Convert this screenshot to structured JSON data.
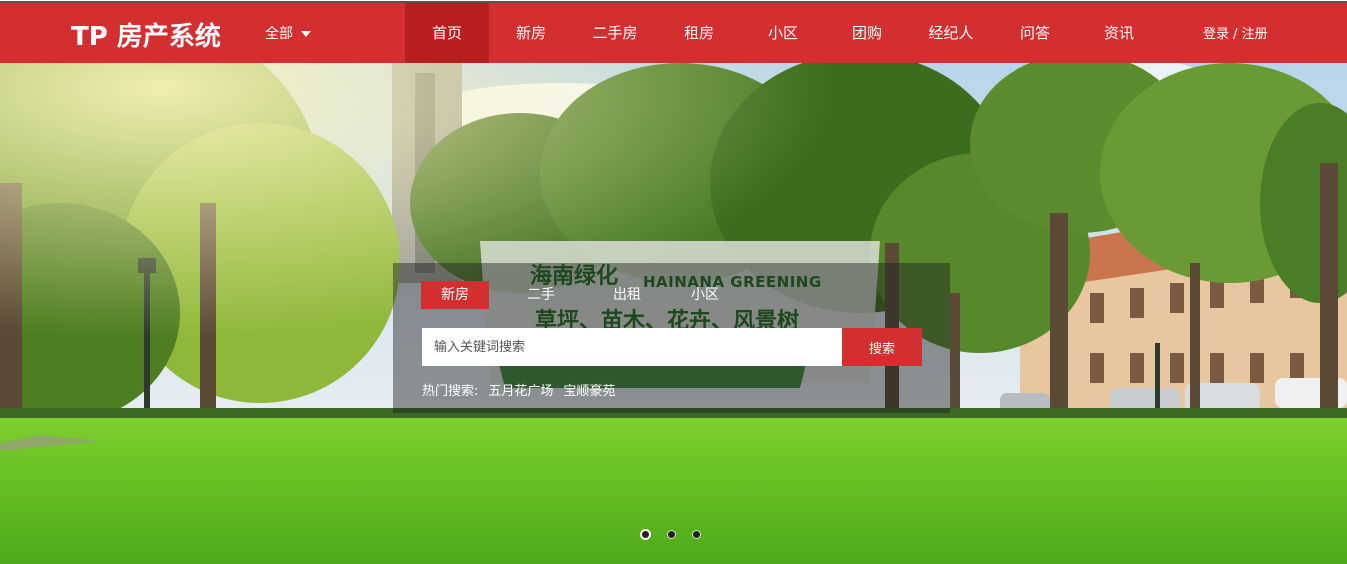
{
  "header": {
    "logo": "TP 房产系统",
    "category_label": "全部",
    "nav": [
      {
        "label": "首页",
        "active": true
      },
      {
        "label": "新房",
        "active": false
      },
      {
        "label": "二手房",
        "active": false
      },
      {
        "label": "租房",
        "active": false
      },
      {
        "label": "小区",
        "active": false
      },
      {
        "label": "团购",
        "active": false
      },
      {
        "label": "经纪人",
        "active": false
      },
      {
        "label": "问答",
        "active": false
      },
      {
        "label": "资讯",
        "active": false
      }
    ],
    "login_label": "登录",
    "separator": " / ",
    "register_label": "注册"
  },
  "hero": {
    "sign": {
      "title": "海南绿化",
      "english": "HAINANA GREENING",
      "subtitle": "草坪、苗木、花卉、风景树"
    },
    "search": {
      "tabs": [
        "新房",
        "二手",
        "出租",
        "小区"
      ],
      "active_tab": 0,
      "placeholder": "输入关键词搜索",
      "value": "",
      "button_label": "搜索",
      "hot_label": "热门搜索:",
      "hot_keywords": [
        "五月花广场",
        "宝顺豪苑"
      ]
    },
    "carousel": {
      "slide_count": 3,
      "active_slide": 0
    }
  },
  "colors": {
    "brand_red": "#d42f30",
    "nav_active": "#b8201f",
    "grass": "#6cc22a",
    "sign_green": "#1c6b1c"
  }
}
